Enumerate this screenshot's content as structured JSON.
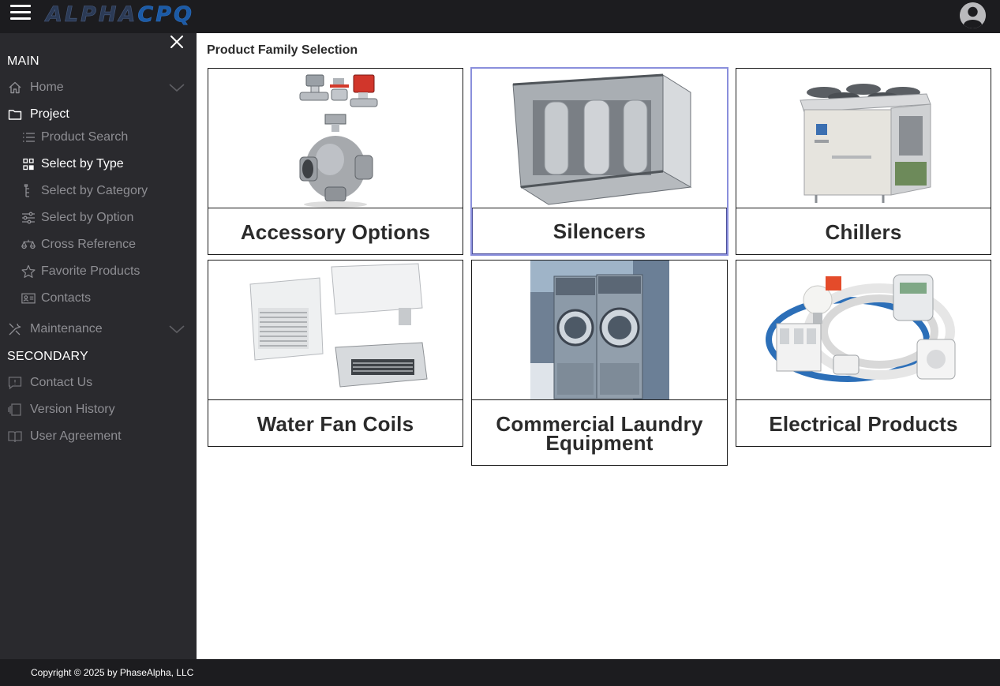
{
  "header": {
    "logo_alpha": "ALPHA",
    "logo_cpq": "CPQ",
    "menu_icon": "hamburger-icon",
    "user_icon": "user-circle-icon"
  },
  "sidebar": {
    "close_icon": "close-icon",
    "main_label": "MAIN",
    "secondary_label": "SECONDARY",
    "home": {
      "label": "Home",
      "icon": "home-icon"
    },
    "project": {
      "label": "Project",
      "icon": "folder-icon"
    },
    "project_items": [
      {
        "label": "Product Search",
        "icon": "list-icon",
        "active": false
      },
      {
        "label": "Select by Type",
        "icon": "grid-icon",
        "active": true
      },
      {
        "label": "Select by Category",
        "icon": "tree-icon",
        "active": false
      },
      {
        "label": "Select by Option",
        "icon": "sliders-icon",
        "active": false
      },
      {
        "label": "Cross Reference",
        "icon": "scale-icon",
        "active": false
      },
      {
        "label": "Favorite Products",
        "icon": "star-icon",
        "active": false
      },
      {
        "label": "Contacts",
        "icon": "contact-card-icon",
        "active": false
      }
    ],
    "maintenance": {
      "label": "Maintenance",
      "icon": "tools-icon"
    },
    "secondary_items": [
      {
        "label": "Contact Us",
        "icon": "message-icon"
      },
      {
        "label": "Version History",
        "icon": "history-icon"
      },
      {
        "label": "User Agreement",
        "icon": "book-icon"
      }
    ]
  },
  "main": {
    "title": "Product Family Selection",
    "cards": [
      {
        "label": "Accessory Options",
        "image": "valve-image",
        "selected": false
      },
      {
        "label": "Silencers",
        "image": "silencer-image",
        "selected": true
      },
      {
        "label": "Chillers",
        "image": "chiller-image",
        "selected": false
      },
      {
        "label": "Water Fan Coils",
        "image": "fan-coil-image",
        "selected": false
      },
      {
        "label_line1": "Commercial Laundry",
        "label_line2": "Equipment",
        "image": "laundry-image",
        "selected": false
      },
      {
        "label": "Electrical Products",
        "image": "electrical-image",
        "selected": false
      }
    ]
  },
  "footer": {
    "copyright": "Copyright © 2025 by PhaseAlpha, LLC"
  },
  "colors": {
    "topbar": "#1c1c1f",
    "sidebar": "#2a2a2e",
    "selected_border": "#8a8fdc",
    "logo_alpha": "#2b3a55",
    "logo_cpq": "#1b5aa6"
  }
}
